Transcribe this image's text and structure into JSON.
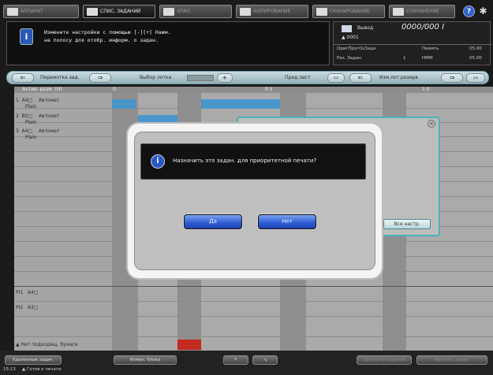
{
  "tabs": [
    {
      "label": "АППАРАТ",
      "active": false
    },
    {
      "label": "СПИС. ЗАДАНИЙ",
      "active": true
    },
    {
      "label": "ХРАН.",
      "active": false
    },
    {
      "label": "КОПИРОВАНИЕ",
      "active": false
    },
    {
      "label": "СКАНИРОВАНИЕ",
      "active": false
    },
    {
      "label": "СОХРАНЕНИЕ",
      "active": false
    }
  ],
  "message": {
    "line1": "Измените настройки с помощью [-][+] Нажм.",
    "line2": "на полосу для отобр. информ. о задан."
  },
  "status": {
    "output_label": "Вывод",
    "counter": "0000/000 I",
    "sub": "0001",
    "row1_left": "ОригПрогОзЗадн",
    "row1_right_label": "Память",
    "row1_value": "05.00",
    "row2_left": "Рез. Задан.",
    "row2_num": "1",
    "row2_right_label": "HMM",
    "row2_value": "05.00"
  },
  "toolbar": {
    "scroll_left": "Перемотка зад.",
    "zoom": "Выбор лотка",
    "prev_list": "Пред.лист",
    "next_ext": "Изм.лот.резерв",
    "buttons": [
      "⇐",
      "⇒",
      "+",
      "‹‹",
      "⇐",
      "⇒",
      "››"
    ]
  },
  "grid": {
    "header_left": "Актив. разм. (Н)",
    "tick_0": "0",
    "tick_05": "0.5",
    "tick_10": "1.0",
    "rows": [
      {
        "num": "1",
        "size": "A4□",
        "type": "Plain",
        "mode": "Автомат"
      },
      {
        "num": "2",
        "size": "B5□",
        "type": "Plain",
        "mode": "Автомат"
      },
      {
        "num": "3",
        "size": "A4□",
        "type": "Plain",
        "mode": "Автомат"
      }
    ],
    "pi1": "PI1",
    "pi1_size": "A4□",
    "pi2": "PI2",
    "pi2_size": "A3□",
    "no_paper": "Нет подходящ. бумаги"
  },
  "panel": {
    "button": "Все настр."
  },
  "dialog": {
    "message": "Назначить это задан. для приоритетной печати?",
    "yes": "Да",
    "no": "Нет"
  },
  "bottom": {
    "left_button": "Удаленные задач.",
    "mid_button": "Измен. блока",
    "arrow1": "↖",
    "arrow2": "↘",
    "status_left": "15:13",
    "status_text": "Готов к печати",
    "right1": "Просмотр задания",
    "right2": "Выполн. задан."
  },
  "colors": {
    "accent": "#48b4b8",
    "dialog_button": "#2c5bd1",
    "grid_bar": "#4a96cc",
    "alert": "#c42a1e"
  }
}
